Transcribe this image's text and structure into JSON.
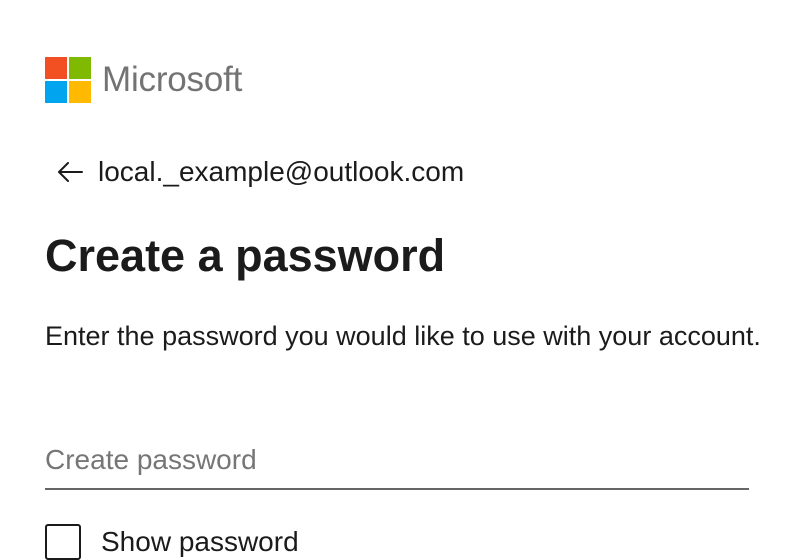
{
  "brand": {
    "name": "Microsoft",
    "logo_colors": [
      "#f25022",
      "#7fba00",
      "#00a4ef",
      "#ffb900"
    ]
  },
  "identity": {
    "email": "local._example@outlook.com",
    "back_icon": "arrow-left-icon"
  },
  "title": "Create a password",
  "description": "Enter the password you would like to use with your account.",
  "password_input": {
    "placeholder": "Create password",
    "value": ""
  },
  "show_password": {
    "label": "Show password",
    "checked": false
  }
}
